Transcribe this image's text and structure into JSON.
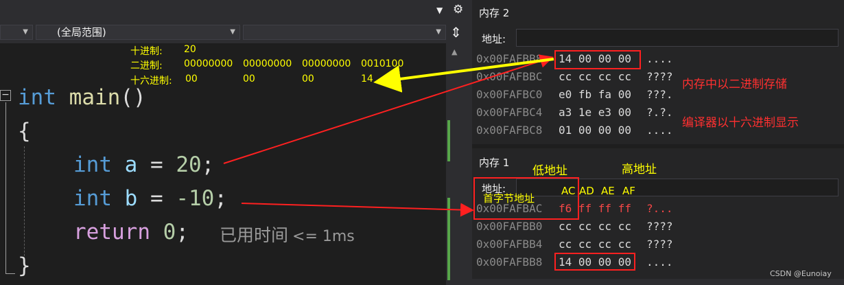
{
  "editor": {
    "scope_dropdown": "(全局范围)",
    "code": {
      "l1_kw": "int",
      "l1_fn": "main",
      "l1_rest": "()",
      "l2": "{",
      "l3_kw": "int",
      "l3_var": "a",
      "l3_op": " = ",
      "l3_num": "20",
      "l3_end": ";",
      "l4_kw": "int",
      "l4_var": "b",
      "l4_op": " = ",
      "l4_num": "-10",
      "l4_end": ";",
      "l5_kw": "return",
      "l5_num": "0",
      "l5_end": ";",
      "l6": "}"
    },
    "perf_tip": "已用时间",
    "perf_value": "<= 1ms",
    "tooltip": {
      "dec_label": "十进制:",
      "dec_value": "20",
      "bin_label": "二进制:",
      "bin_values": [
        "00000000",
        "00000000",
        "00000000",
        "0010100"
      ],
      "hex_label": "十六进制:",
      "hex_values": [
        "00",
        "00",
        "00",
        "14"
      ]
    }
  },
  "memory2": {
    "title": "内存 2",
    "addr_label": "地址:",
    "rows": [
      {
        "addr": "0x00FAFBB8",
        "bytes": "14 00 00 00",
        "ascii": "...."
      },
      {
        "addr": "0x00FAFBBC",
        "bytes": "cc cc cc cc",
        "ascii": "????"
      },
      {
        "addr": "0x00FAFBC0",
        "bytes": "e0 fb fa 00",
        "ascii": "???."
      },
      {
        "addr": "0x00FAFBC4",
        "bytes": "a3 1e e3 00",
        "ascii": "?.?."
      },
      {
        "addr": "0x00FAFBC8",
        "bytes": "01 00 00 00",
        "ascii": "...."
      }
    ],
    "note1": "内存中以二进制存储",
    "note2": "编译器以十六进制显示"
  },
  "memory1": {
    "title": "内存 1",
    "addr_label": "地址:",
    "low_label": "低地址",
    "high_label": "高地址",
    "col_headers": [
      "AC",
      "AD",
      "AE",
      "AF"
    ],
    "first_byte_label": "首字节地址",
    "rows": [
      {
        "addr": "0x00FAFBAC",
        "bytes": "f6 ff ff ff",
        "ascii": "?..."
      },
      {
        "addr": "0x00FAFBB0",
        "bytes": "cc cc cc cc",
        "ascii": "????"
      },
      {
        "addr": "0x00FAFBB4",
        "bytes": "cc cc cc cc",
        "ascii": "????"
      },
      {
        "addr": "0x00FAFBB8",
        "bytes": "14 00 00 00",
        "ascii": "...."
      }
    ]
  },
  "watermark": "CSDN @Eunoiay",
  "colors": {
    "annotation_red": "#ff2020",
    "annotation_yellow": "#ffff00"
  }
}
